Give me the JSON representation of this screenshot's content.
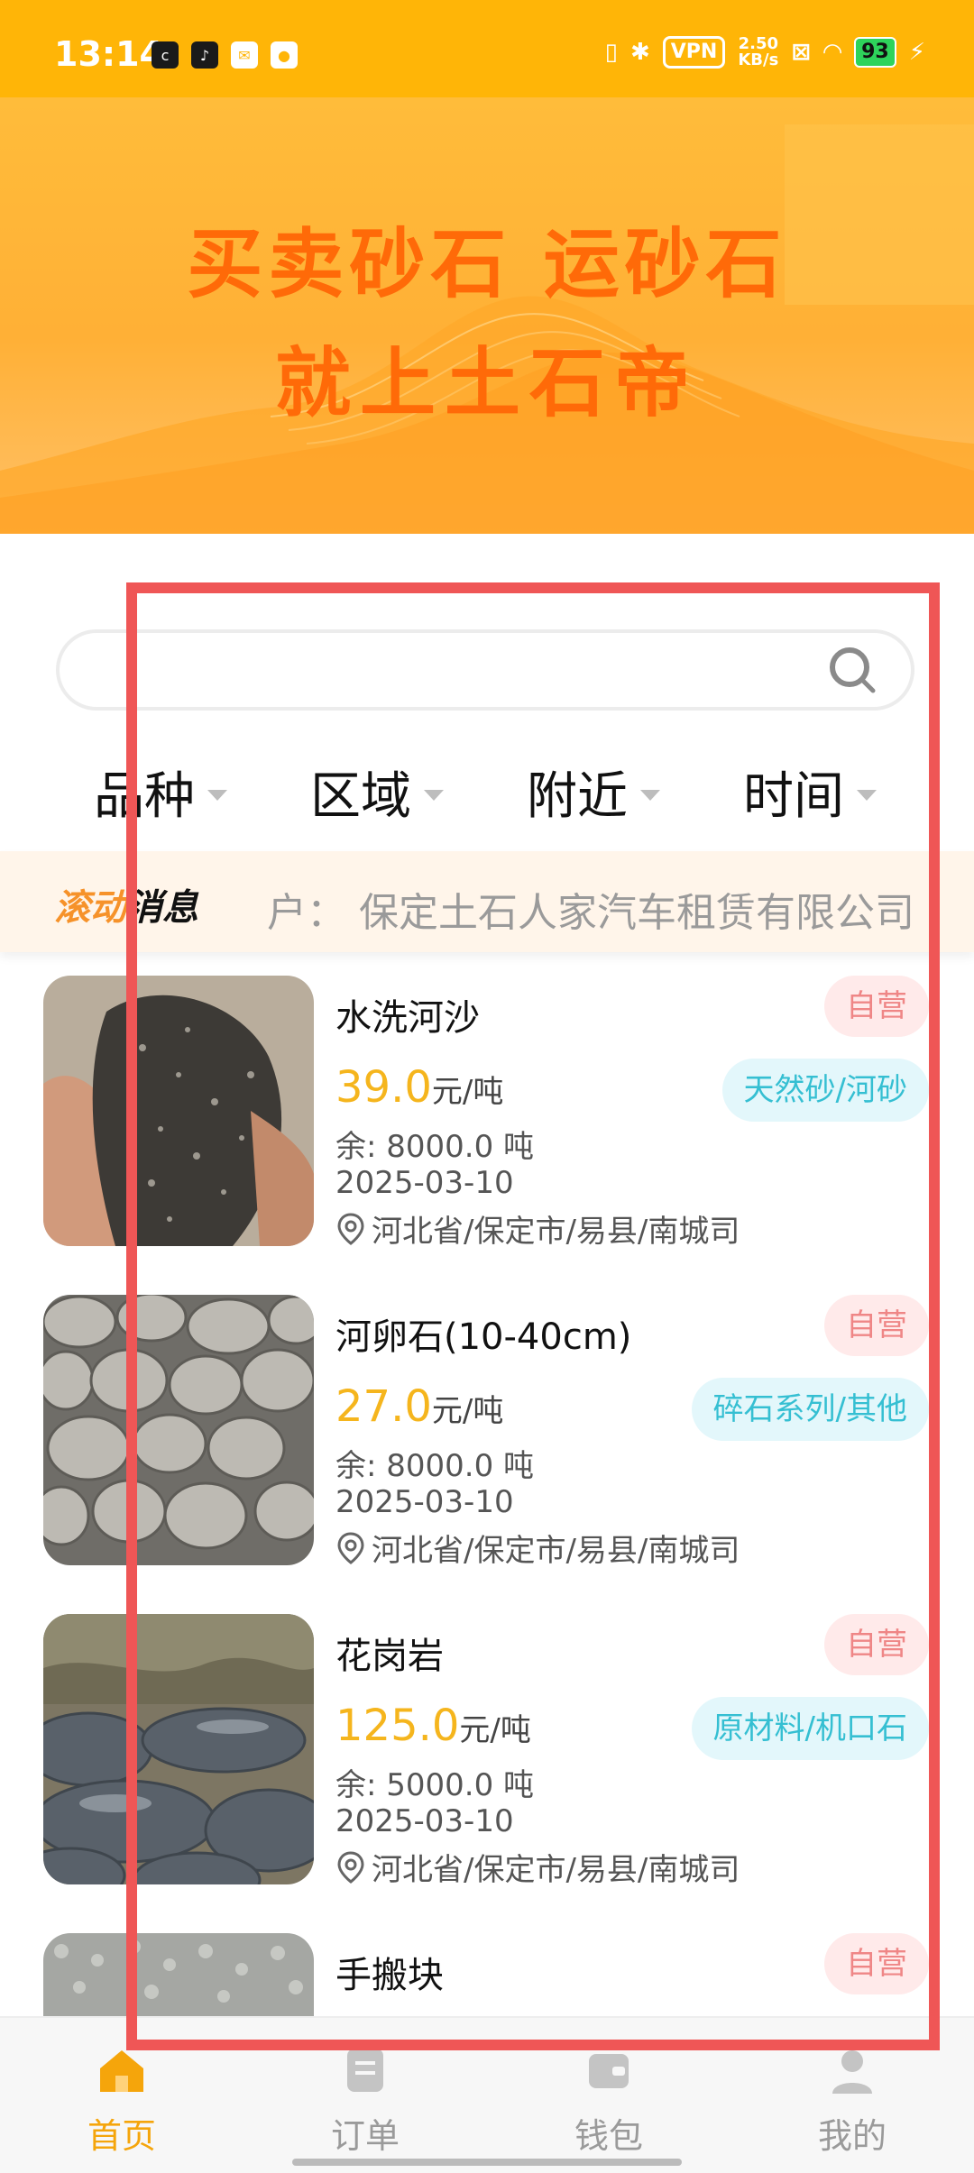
{
  "status_bar": {
    "time": "13:14",
    "notification_icons": [
      "cc-app-icon",
      "tiktok-icon",
      "mail-icon",
      "qq-icon"
    ],
    "vpn": "VPN",
    "speed_value": "2.50",
    "speed_unit": "KB/s",
    "battery": "93"
  },
  "banner": {
    "line1": "买卖砂石 运砂石",
    "line2": "就上土石帝",
    "text_color": "#ff6a08",
    "bg_color": "#ffb036"
  },
  "search": {
    "placeholder": ""
  },
  "filters": [
    {
      "label": "品种"
    },
    {
      "label": "区域"
    },
    {
      "label": "附近"
    },
    {
      "label": "时间"
    }
  ],
  "ticker": {
    "label_part1": "滚动",
    "label_part2": "消息",
    "text": "户： 保定土石人家汽车租赁有限公司"
  },
  "products": [
    {
      "name": "水洗河沙",
      "price": "39.0",
      "unit": "元/吨",
      "stock": "余: 8000.0 吨",
      "date": "2025-03-10",
      "location": "河北省/保定市/易县/南城司",
      "self_tag": "自营",
      "category": "天然砂/河砂"
    },
    {
      "name": "河卵石(10-40cm)",
      "price": "27.0",
      "unit": "元/吨",
      "stock": "余: 8000.0 吨",
      "date": "2025-03-10",
      "location": "河北省/保定市/易县/南城司",
      "self_tag": "自营",
      "category": "碎石系列/其他"
    },
    {
      "name": "花岗岩",
      "price": "125.0",
      "unit": "元/吨",
      "stock": "余: 5000.0 吨",
      "date": "2025-03-10",
      "location": "河北省/保定市/易县/南城司",
      "self_tag": "自营",
      "category": "原材料/机口石"
    },
    {
      "name": "手搬块",
      "self_tag": "自营"
    }
  ],
  "tabbar": {
    "tabs": [
      {
        "label": "首页",
        "icon": "home-icon",
        "active": true
      },
      {
        "label": "订单",
        "icon": "order-icon",
        "active": false
      },
      {
        "label": "钱包",
        "icon": "wallet-icon",
        "active": false
      },
      {
        "label": "我的",
        "icon": "profile-icon",
        "active": false
      }
    ],
    "active_color": "#f5a50b"
  },
  "colors": {
    "accent": "#ffb507",
    "price": "#f5b51d",
    "self_tag_text": "#ef8686",
    "category_tag_text": "#35bfd2",
    "highlight_box": "#ef5656"
  }
}
